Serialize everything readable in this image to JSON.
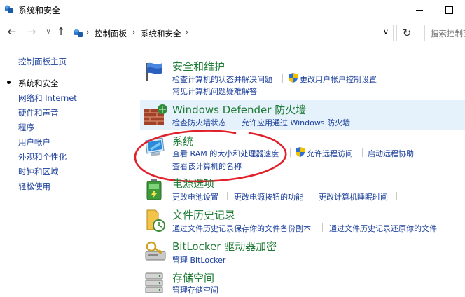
{
  "window": {
    "title": "系统和安全"
  },
  "address": {
    "crumbs": [
      "控制面板",
      "系统和安全"
    ],
    "search_placeholder": "搜索控制面"
  },
  "nav": {
    "back_glyph": "←",
    "forward_glyph": "→",
    "recent_glyph": "∨",
    "up_glyph": "↑",
    "refresh_glyph": "↻",
    "crumb_sep": "›",
    "dropdown_glyph": "∨"
  },
  "leftnav": [
    {
      "label": "控制面板主页"
    },
    {
      "label": "系统和安全"
    },
    {
      "label": "网络和 Internet"
    },
    {
      "label": "硬件和声音"
    },
    {
      "label": "程序"
    },
    {
      "label": "用户帐户"
    },
    {
      "label": "外观和个性化"
    },
    {
      "label": "时钟和区域"
    },
    {
      "label": "轻松使用"
    }
  ],
  "categories": {
    "security": {
      "title": "安全和维护",
      "links": [
        "检查计算机的状态并解决问题",
        "更改用户帐户控制设置",
        "常见计算机问题疑难解答"
      ]
    },
    "firewall": {
      "title": "Windows Defender 防火墙",
      "links": [
        "检查防火墙状态",
        "允许应用通过 Windows 防火墙"
      ]
    },
    "system": {
      "title": "系统",
      "links": [
        "查看 RAM 的大小和处理器速度",
        "允许远程访问",
        "启动远程协助",
        "查看该计算机的名称"
      ]
    },
    "power": {
      "title": "电源选项",
      "links": [
        "更改电池设置",
        "更改电源按钮的功能",
        "更改计算机睡眠时间"
      ]
    },
    "history": {
      "title": "文件历史记录",
      "links": [
        "通过文件历史记录保存你的文件备份副本",
        "通过文件历史记录还原你的文件"
      ]
    },
    "bitlocker": {
      "title": "BitLocker 驱动器加密",
      "links": [
        "管理 BitLocker"
      ]
    },
    "storage": {
      "title": "存储空间",
      "links": [
        "管理存储空间"
      ]
    }
  },
  "colors": {
    "category_title": "#1e7b35",
    "link": "#1a3e9a",
    "highlight": "#e5f1fb",
    "annotation": "#e0202a"
  }
}
